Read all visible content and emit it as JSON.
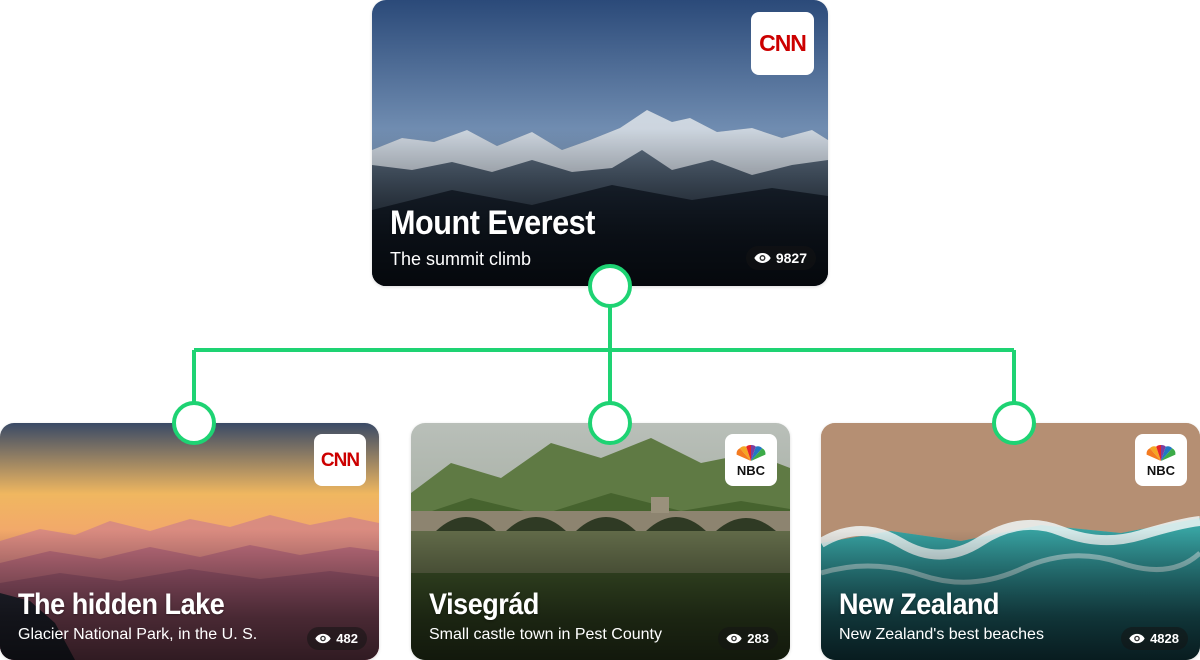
{
  "colors": {
    "connector": "#1ed373",
    "cnn_red": "#cc0000"
  },
  "root": {
    "title": "Mount Everest",
    "subtitle": "The summit climb",
    "views": "9827",
    "logo": "CNN",
    "icon": "eye-icon"
  },
  "children": [
    {
      "title": "The hidden Lake",
      "subtitle": "Glacier National Park, in the U. S.",
      "views": "482",
      "logo": "CNN",
      "icon": "eye-icon"
    },
    {
      "title": "Visegrád",
      "subtitle": "Small castle town in Pest County",
      "views": "283",
      "logo": "NBC",
      "icon": "eye-icon"
    },
    {
      "title": "New Zealand",
      "subtitle": "New Zealand's best beaches",
      "views": "4828",
      "logo": "NBC",
      "icon": "eye-icon"
    }
  ]
}
